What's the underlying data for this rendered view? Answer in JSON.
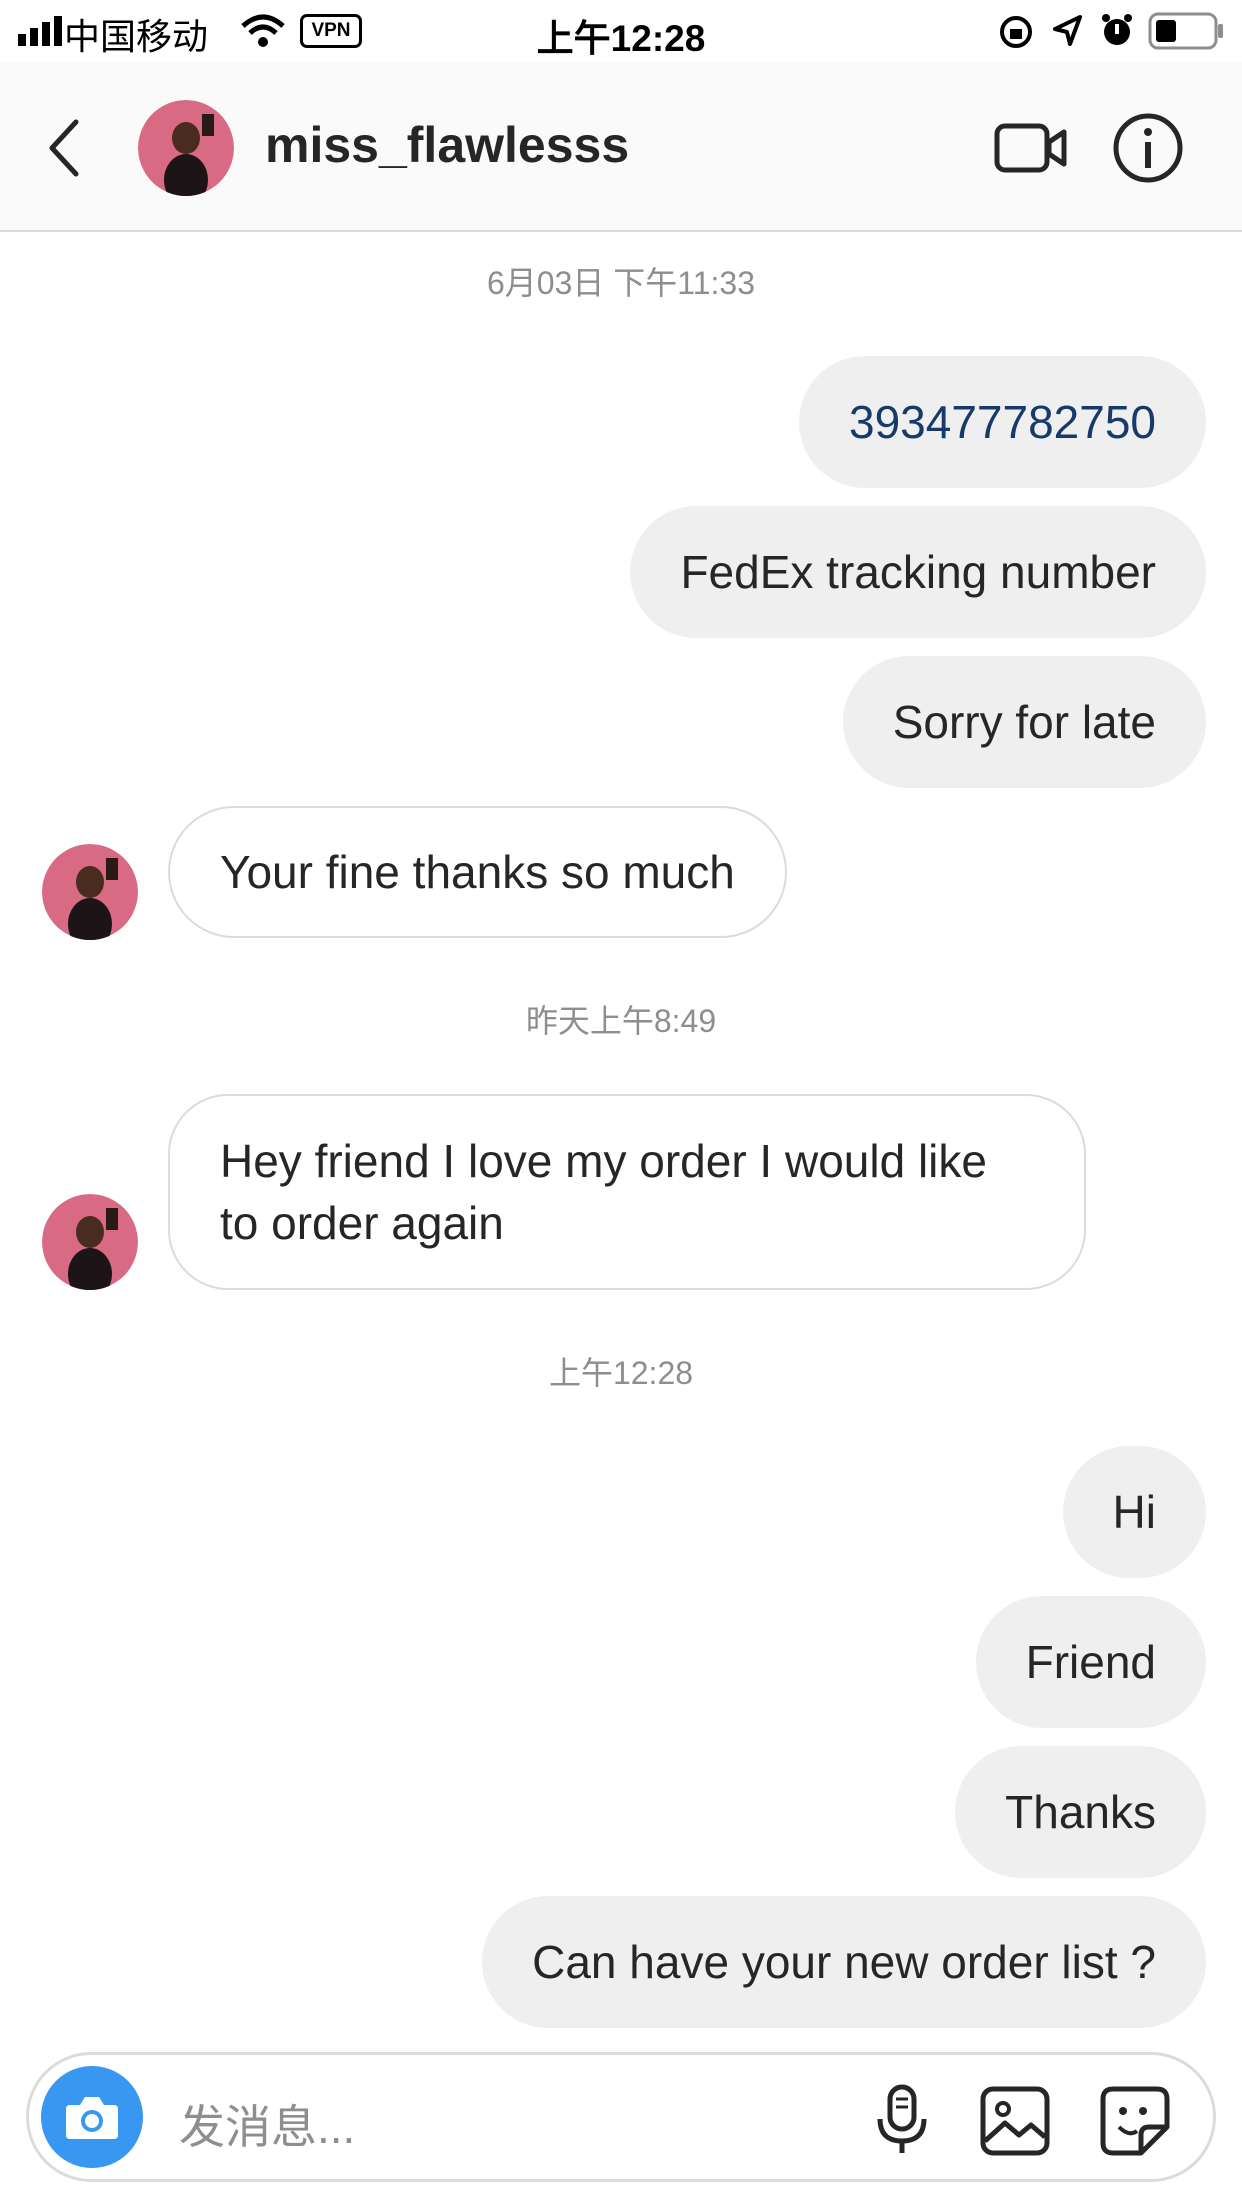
{
  "status_bar": {
    "carrier": "中国移动",
    "vpn": "VPN",
    "time": "上午12:28"
  },
  "header": {
    "username": "miss_flawlesss",
    "icons": [
      "back-chevron-icon",
      "video-call-icon",
      "info-icon"
    ]
  },
  "messages": {
    "stamp1": "6月03日 下午11:33",
    "m1": "393477782750",
    "m2": "FedEx tracking number",
    "m3": "Sorry for late",
    "m4": "Your fine thanks so much",
    "stamp2": "昨天上午8:49",
    "m5_line1": "Hey friend I love my order I would like",
    "m5_line2": "to order again",
    "stamp3": "上午12:28",
    "m6": "Hi",
    "m7": "Friend",
    "m8": "Thanks",
    "m9": "Can have your new order list ?"
  },
  "composer": {
    "placeholder": "发消息..."
  },
  "colors": {
    "outgoing_bubble": "#efefef",
    "link_number": "#173a6b",
    "camera_button": "#3897f0"
  }
}
